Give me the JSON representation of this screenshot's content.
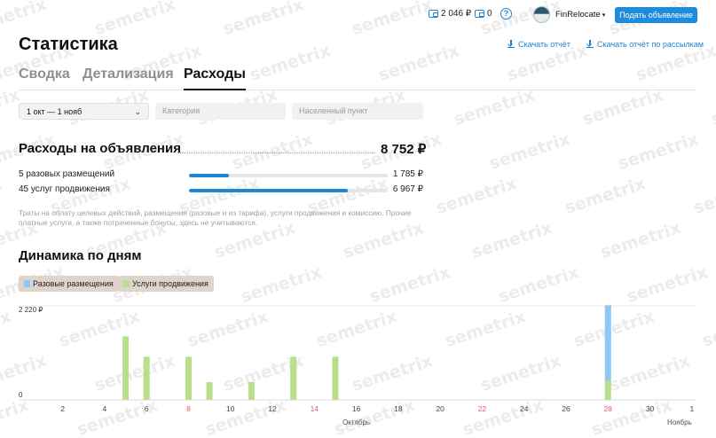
{
  "header": {
    "balance": "2 046 ₽",
    "bonus": "0",
    "help_icon": "question-circle-icon",
    "account_name": "FinRelocate",
    "place_ad_label": "Подать объявление"
  },
  "page": {
    "title": "Статистика",
    "download_report": "Скачать отчёт",
    "download_mailing_report": "Скачать отчёт по рассылкам"
  },
  "tabs": [
    {
      "label": "Сводка",
      "active": false
    },
    {
      "label": "Детализация",
      "active": false
    },
    {
      "label": "Расходы",
      "active": true
    }
  ],
  "filters": {
    "date": "1 окт — 1 нояб",
    "category_placeholder": "Категория",
    "locality_placeholder": "Населенный пункт"
  },
  "expenses": {
    "title": "Расходы на объявления",
    "total": "8 752 ₽",
    "rows": [
      {
        "label": "5 разовых размещений",
        "value": "1 785 ₽",
        "share": 0.2
      },
      {
        "label": "45 услуг продвижения",
        "value": "6 967 ₽",
        "share": 0.8
      }
    ],
    "note": "Траты на оплату целевых действий, размещения (разовые и из тарифа), услуги продвижения и комиссию. Прочие платные услуги, а также потраченные бонусы, здесь не учитываются."
  },
  "dynamics": {
    "title": "Динамика по дням",
    "legend": [
      {
        "label": "Разовые размещения",
        "color": "#8cc8f2"
      },
      {
        "label": "Услуги продвижения",
        "color": "#b8e08a"
      }
    ]
  },
  "watermark": "semetrix",
  "colors": {
    "accent": "#1f8bdb",
    "bar_one_time": "#8cc8f2",
    "bar_promo": "#b8e08a",
    "weekend_tick": "#e06060"
  },
  "chart_data": {
    "type": "bar",
    "stacked": true,
    "x": [
      1,
      2,
      3,
      4,
      5,
      6,
      7,
      8,
      9,
      10,
      11,
      12,
      13,
      14,
      15,
      16,
      17,
      18,
      19,
      20,
      21,
      22,
      23,
      24,
      25,
      26,
      27,
      28,
      29,
      30,
      31,
      32
    ],
    "x_tick_labels": [
      "2",
      "4",
      "6",
      "8",
      "10",
      "12",
      "14",
      "16",
      "18",
      "20",
      "22",
      "24",
      "26",
      "28",
      "30",
      "1"
    ],
    "x_tick_values": [
      2,
      4,
      6,
      8,
      10,
      12,
      14,
      16,
      18,
      20,
      22,
      24,
      26,
      28,
      30,
      32
    ],
    "red_ticks": [
      "8",
      "14",
      "22",
      "28"
    ],
    "month_labels": [
      {
        "label": "Октябрь",
        "at": 16
      },
      {
        "label": "Ноябрь",
        "at": 32
      }
    ],
    "y_tick_labels": [
      "0",
      "2 220 ₽"
    ],
    "ylim": [
      0,
      2220
    ],
    "grid": false,
    "series": [
      {
        "name": "Разовые размещения",
        "values": [
          0,
          0,
          0,
          0,
          0,
          0,
          0,
          0,
          0,
          0,
          0,
          0,
          0,
          0,
          0,
          0,
          0,
          0,
          0,
          0,
          0,
          0,
          0,
          0,
          0,
          0,
          0,
          1785,
          0,
          0,
          0,
          0
        ]
      },
      {
        "name": "Услуги продвижения",
        "values": [
          0,
          0,
          0,
          0,
          1500,
          1020,
          0,
          1020,
          420,
          0,
          420,
          0,
          1020,
          0,
          1020,
          0,
          0,
          0,
          0,
          0,
          0,
          0,
          0,
          0,
          0,
          0,
          0,
          450,
          0,
          0,
          0,
          0
        ]
      }
    ]
  }
}
